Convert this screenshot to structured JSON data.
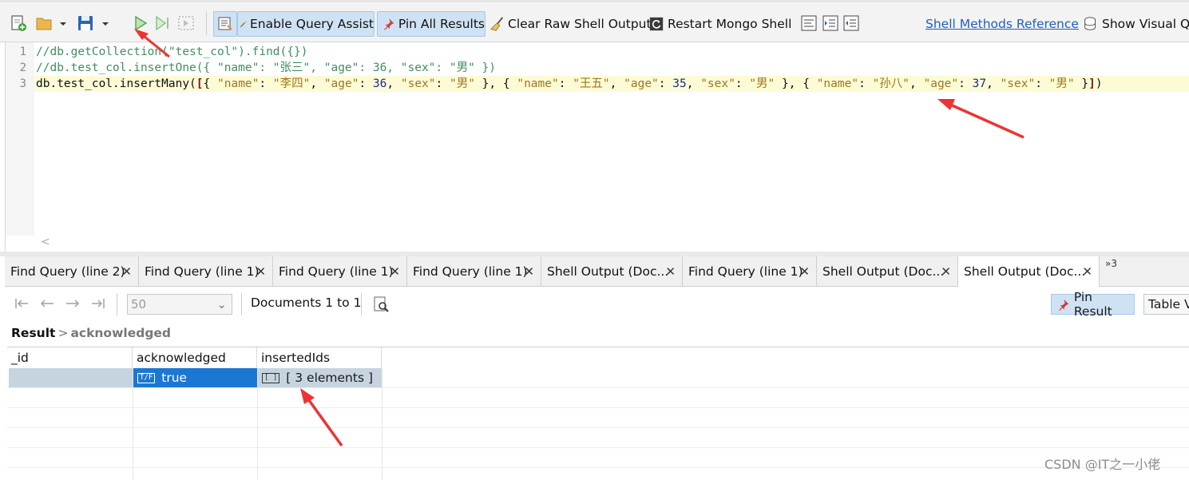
{
  "toolbar": {
    "enable_query_assist": "Enable Query Assist",
    "pin_all_results": "Pin All Results",
    "clear_raw_shell_output": "Clear Raw Shell Output",
    "restart_mongo_shell": "Restart Mongo Shell",
    "shell_methods_reference": "Shell Methods Reference",
    "show_visual": "Show Visual Qu"
  },
  "editor": {
    "line_numbers": [
      "1",
      "2",
      "3"
    ],
    "lines": [
      "//db.getCollection(\"test_col\").find({})",
      "//db.test_col.insertOne({ \"name\": \"张三\", \"age\": 36, \"sex\": \"男\" })",
      "db.test_col.insertMany([{ \"name\": \"李四\", \"age\": 36, \"sex\": \"男\" }, { \"name\": \"王五\", \"age\": 35, \"sex\": \"男\" }, { \"name\": \"孙八\", \"age\": 37, \"sex\": \"男\" }])"
    ],
    "scroll_left": "<"
  },
  "tabs": [
    {
      "label": "Find Query (line 2)"
    },
    {
      "label": "Find Query (line 1)"
    },
    {
      "label": "Find Query (line 1)"
    },
    {
      "label": "Find Query (line 1)"
    },
    {
      "label": "Shell Output (Doc..."
    },
    {
      "label": "Find Query (line 1)"
    },
    {
      "label": "Shell Output (Doc..."
    },
    {
      "label": "Shell Output (Doc..."
    }
  ],
  "tab_close": "✕",
  "tab_overflow": "»3",
  "results": {
    "page_size": "50",
    "documents_label": "Documents 1 to 1",
    "pin_result": "Pin Result",
    "table_view": "Table V",
    "breadcrumb": {
      "root": "Result",
      "separator": ">",
      "current": "acknowledged"
    },
    "columns": [
      "_id",
      "acknowledged",
      "insertedIds"
    ],
    "row": {
      "id": "",
      "acknowledged_type": "T/F",
      "acknowledged": "true",
      "insertedIds_type": "[ ]",
      "insertedIds": "[ 3 elements ]"
    }
  },
  "watermark": "CSDN @IT之一小佬",
  "colors": {
    "accent": "#1a78d2",
    "pressed": "#cfe2f3",
    "annotation": "#ee3333"
  }
}
